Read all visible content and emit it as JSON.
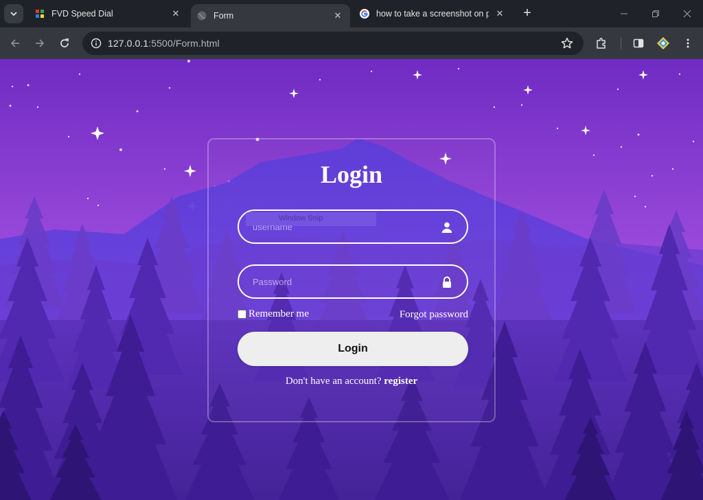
{
  "browser": {
    "tabs": [
      {
        "title": "FVD Speed Dial",
        "favicon": "fvd-speed-dial-icon",
        "active": false
      },
      {
        "title": "Form",
        "favicon": "globe-icon",
        "active": true
      },
      {
        "title": "how to take a screenshot on pc",
        "favicon": "google-icon",
        "active": false
      }
    ],
    "address_bar": {
      "url_host": "127.0.0.1",
      "url_rest": ":5500/Form.html"
    }
  },
  "page": {
    "title": "Login",
    "username": {
      "placeholder": "username",
      "value": "",
      "icon": "user-icon"
    },
    "password": {
      "placeholder": "Password",
      "value": "",
      "icon": "lock-icon"
    },
    "snip_overlay_text": "Window Snip",
    "remember_label": "Remember me",
    "remember_checked": false,
    "forgot_label": "Forgot password",
    "login_button": "Login",
    "register_prompt": "Don't have an account? ",
    "register_link": "register"
  },
  "colors": {
    "chrome_dark": "#1f2329",
    "chrome_toolbar": "#35393f",
    "sky_top": "#7a2fc8",
    "sky_horizon": "#d08ae8",
    "forest_dark": "#3a1f85",
    "button_bg": "#efeeee"
  }
}
